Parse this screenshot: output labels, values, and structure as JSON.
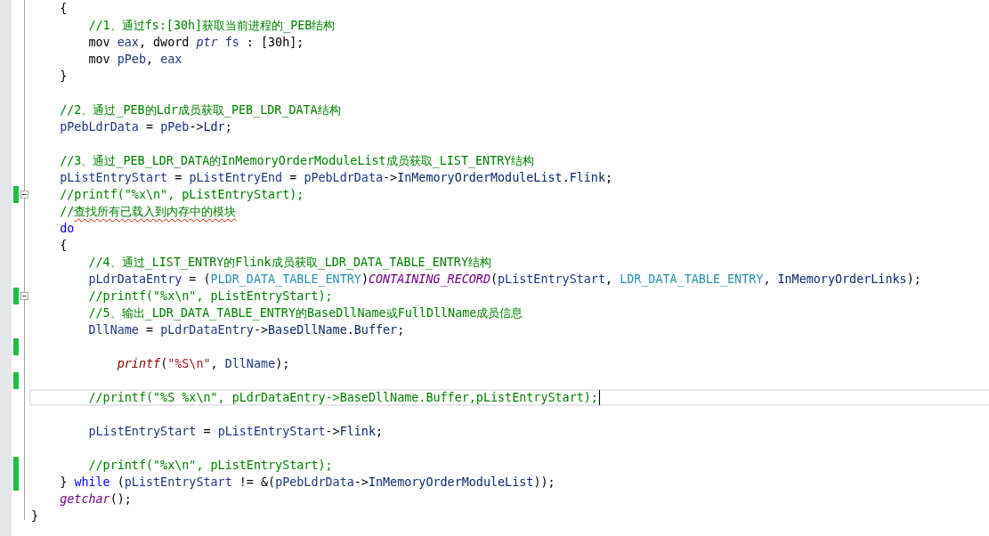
{
  "editor": {
    "lines": [
      {
        "kind": "code",
        "changed": false,
        "fold": false,
        "current": false,
        "tokens": [
          {
            "text": "    {",
            "kind": "plain"
          }
        ]
      },
      {
        "kind": "code",
        "changed": false,
        "fold": false,
        "current": false,
        "tokens": [
          {
            "text": "        //1、通过fs:[30h]获取当前进程的_PEB结构",
            "kind": "comment"
          }
        ]
      },
      {
        "kind": "code",
        "changed": false,
        "fold": false,
        "current": false,
        "tokens": [
          {
            "text": "        mov ",
            "kind": "plain"
          },
          {
            "text": "eax",
            "kind": "ident"
          },
          {
            "text": ", dword ",
            "kind": "plain"
          },
          {
            "text": "ptr",
            "kind": "ident-italic"
          },
          {
            "text": " fs",
            "kind": "ident"
          },
          {
            "text": " : [30h];",
            "kind": "plain"
          }
        ]
      },
      {
        "kind": "code",
        "changed": false,
        "fold": false,
        "current": false,
        "tokens": [
          {
            "text": "        mov ",
            "kind": "plain"
          },
          {
            "text": "pPeb",
            "kind": "ident"
          },
          {
            "text": ", ",
            "kind": "plain"
          },
          {
            "text": "eax",
            "kind": "ident"
          }
        ]
      },
      {
        "kind": "code",
        "changed": false,
        "fold": false,
        "current": false,
        "tokens": [
          {
            "text": "    }",
            "kind": "plain"
          }
        ]
      },
      {
        "kind": "blank",
        "changed": false,
        "fold": false,
        "current": false
      },
      {
        "kind": "code",
        "changed": false,
        "fold": false,
        "current": false,
        "tokens": [
          {
            "text": "    //2、通过_PEB的Ldr成员获取_PEB_LDR_DATA结构",
            "kind": "comment"
          }
        ]
      },
      {
        "kind": "code",
        "changed": false,
        "fold": false,
        "current": false,
        "tokens": [
          {
            "text": "    pPebLdrData",
            "kind": "ident"
          },
          {
            "text": " = ",
            "kind": "plain"
          },
          {
            "text": "pPeb",
            "kind": "ident"
          },
          {
            "text": "->",
            "kind": "plain"
          },
          {
            "text": "Ldr",
            "kind": "member"
          },
          {
            "text": ";",
            "kind": "plain"
          }
        ]
      },
      {
        "kind": "blank",
        "changed": false,
        "fold": false,
        "current": false
      },
      {
        "kind": "code",
        "changed": false,
        "fold": false,
        "current": false,
        "tokens": [
          {
            "text": "    //3、通过_PEB_LDR_DATA的InMemoryOrderModuleList成员获取_LIST_ENTRY结构",
            "kind": "comment"
          }
        ]
      },
      {
        "kind": "code",
        "changed": false,
        "fold": false,
        "current": false,
        "tokens": [
          {
            "text": "    pListEntryStart",
            "kind": "ident"
          },
          {
            "text": " = ",
            "kind": "plain"
          },
          {
            "text": "pListEntryEnd",
            "kind": "ident"
          },
          {
            "text": " = ",
            "kind": "plain"
          },
          {
            "text": "pPebLdrData",
            "kind": "ident"
          },
          {
            "text": "->",
            "kind": "plain"
          },
          {
            "text": "InMemoryOrderModuleList",
            "kind": "member"
          },
          {
            "text": ".",
            "kind": "plain"
          },
          {
            "text": "Flink",
            "kind": "member"
          },
          {
            "text": ";",
            "kind": "plain"
          }
        ]
      },
      {
        "kind": "code",
        "changed": true,
        "fold": true,
        "current": false,
        "tokens": [
          {
            "text": "    //printf(\"%x\\n\", pListEntryStart);",
            "kind": "comment"
          }
        ]
      },
      {
        "kind": "code",
        "changed": false,
        "fold": false,
        "current": false,
        "tokens": [
          {
            "text": "    //",
            "kind": "comment"
          },
          {
            "text": "查找所有已载入到内存中的模块",
            "kind": "comment-misspelled"
          }
        ]
      },
      {
        "kind": "code",
        "changed": false,
        "fold": false,
        "current": false,
        "tokens": [
          {
            "text": "    do",
            "kind": "keyword"
          }
        ]
      },
      {
        "kind": "code",
        "changed": false,
        "fold": false,
        "current": false,
        "tokens": [
          {
            "text": "    {",
            "kind": "plain"
          }
        ]
      },
      {
        "kind": "code",
        "changed": false,
        "fold": false,
        "current": false,
        "tokens": [
          {
            "text": "        //4、通过_LIST_ENTRY的Flink成员获取_LDR_DATA_TABLE_ENTRY结构",
            "kind": "comment"
          }
        ]
      },
      {
        "kind": "code",
        "changed": false,
        "fold": false,
        "current": false,
        "tokens": [
          {
            "text": "        pLdrDataEntry",
            "kind": "ident"
          },
          {
            "text": " = (",
            "kind": "plain"
          },
          {
            "text": "PLDR_DATA_TABLE_ENTRY",
            "kind": "type"
          },
          {
            "text": ")",
            "kind": "plain"
          },
          {
            "text": "CONTAINING_RECORD",
            "kind": "macro"
          },
          {
            "text": "(",
            "kind": "plain"
          },
          {
            "text": "pListEntryStart",
            "kind": "ident"
          },
          {
            "text": ", ",
            "kind": "plain"
          },
          {
            "text": "LDR_DATA_TABLE_ENTRY",
            "kind": "type"
          },
          {
            "text": ", ",
            "kind": "plain"
          },
          {
            "text": "InMemoryOrderLinks",
            "kind": "member"
          },
          {
            "text": ");",
            "kind": "plain"
          }
        ]
      },
      {
        "kind": "code",
        "changed": true,
        "fold": true,
        "current": false,
        "tokens": [
          {
            "text": "        //printf(\"%x\\n\", pListEntryStart);",
            "kind": "comment"
          }
        ]
      },
      {
        "kind": "code",
        "changed": false,
        "fold": false,
        "current": false,
        "tokens": [
          {
            "text": "        //5、输出_LDR_DATA_TABLE_ENTRY的BaseDllName或FullDllName成员信息",
            "kind": "comment"
          }
        ]
      },
      {
        "kind": "code",
        "changed": false,
        "fold": false,
        "current": false,
        "tokens": [
          {
            "text": "        DllName",
            "kind": "ident"
          },
          {
            "text": " = ",
            "kind": "plain"
          },
          {
            "text": "pLdrDataEntry",
            "kind": "ident"
          },
          {
            "text": "->",
            "kind": "plain"
          },
          {
            "text": "BaseDllName",
            "kind": "member"
          },
          {
            "text": ".",
            "kind": "plain"
          },
          {
            "text": "Buffer",
            "kind": "member"
          },
          {
            "text": ";",
            "kind": "plain"
          }
        ]
      },
      {
        "kind": "blank",
        "changed": true,
        "fold": false,
        "current": false
      },
      {
        "kind": "code",
        "changed": false,
        "fold": false,
        "current": false,
        "tokens": [
          {
            "text": "            printf",
            "kind": "func"
          },
          {
            "text": "(",
            "kind": "plain"
          },
          {
            "text": "\"%S\\n\"",
            "kind": "string"
          },
          {
            "text": ", ",
            "kind": "plain"
          },
          {
            "text": "DllName",
            "kind": "ident"
          },
          {
            "text": ");",
            "kind": "plain"
          }
        ]
      },
      {
        "kind": "blank",
        "changed": true,
        "fold": false,
        "current": false
      },
      {
        "kind": "code",
        "changed": false,
        "fold": false,
        "current": true,
        "tokens": [
          {
            "text": "        //printf(\"%S %x\\n\", pLdrDataEntry->BaseDllName.Buffer,pListEntryStart);",
            "kind": "comment"
          }
        ]
      },
      {
        "kind": "blank",
        "changed": false,
        "fold": false,
        "current": false
      },
      {
        "kind": "code",
        "changed": false,
        "fold": false,
        "current": false,
        "tokens": [
          {
            "text": "        pListEntryStart",
            "kind": "ident"
          },
          {
            "text": " = ",
            "kind": "plain"
          },
          {
            "text": "pListEntryStart",
            "kind": "ident"
          },
          {
            "text": "->",
            "kind": "plain"
          },
          {
            "text": "Flink",
            "kind": "member"
          },
          {
            "text": ";",
            "kind": "plain"
          }
        ]
      },
      {
        "kind": "blank",
        "changed": false,
        "fold": false,
        "current": false
      },
      {
        "kind": "code",
        "changed": true,
        "fold": false,
        "current": false,
        "tokens": [
          {
            "text": "        //printf(\"%x\\n\", pListEntryStart);",
            "kind": "comment"
          }
        ]
      },
      {
        "kind": "code",
        "changed": true,
        "fold": false,
        "current": false,
        "tokens": [
          {
            "text": "    } ",
            "kind": "plain"
          },
          {
            "text": "while",
            "kind": "keyword"
          },
          {
            "text": " (",
            "kind": "plain"
          },
          {
            "text": "pListEntryStart",
            "kind": "ident"
          },
          {
            "text": " != &(",
            "kind": "plain"
          },
          {
            "text": "pPebLdrData",
            "kind": "ident"
          },
          {
            "text": "->",
            "kind": "plain"
          },
          {
            "text": "InMemoryOrderModuleList",
            "kind": "member"
          },
          {
            "text": "));",
            "kind": "plain"
          }
        ]
      },
      {
        "kind": "code",
        "changed": false,
        "fold": false,
        "current": false,
        "tokens": [
          {
            "text": "    getchar",
            "kind": "macro"
          },
          {
            "text": "();",
            "kind": "plain"
          }
        ]
      },
      {
        "kind": "code",
        "changed": false,
        "fold": false,
        "current": false,
        "tokens": [
          {
            "text": "}",
            "kind": "plain"
          }
        ]
      }
    ]
  }
}
